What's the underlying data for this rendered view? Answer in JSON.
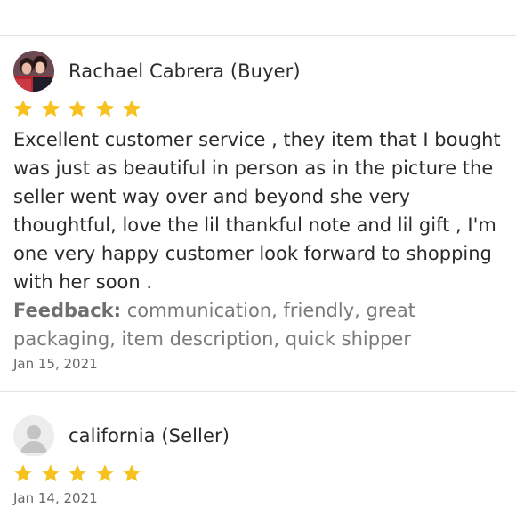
{
  "reviews": [
    {
      "reviewer": "Rachael Cabrera (Buyer)",
      "rating": 5,
      "lines": [
        "Excellent customer service , they item that I bought",
        "was just as beautiful in person as in the picture the",
        "seller went way over and beyond she very",
        "thoughtful, love the lil thankful note and lil gift , I'm",
        "one very happy customer look forward to shopping",
        "with her soon ."
      ],
      "feedback_label": "Feedback:",
      "feedback_line1": "communication, friendly, great",
      "feedback_line2": "packaging, item description, quick shipper",
      "date": "Jan 15, 2021",
      "avatar_icon": "profile-photo"
    },
    {
      "reviewer": "california (Seller)",
      "rating": 5,
      "date": "Jan 14, 2021",
      "avatar_icon": "default-user-avatar-icon"
    }
  ],
  "colors": {
    "star": "#f7c21f",
    "text": "#2b2b2b",
    "muted": "#7a7a7a",
    "divider": "#e3e3e3"
  }
}
